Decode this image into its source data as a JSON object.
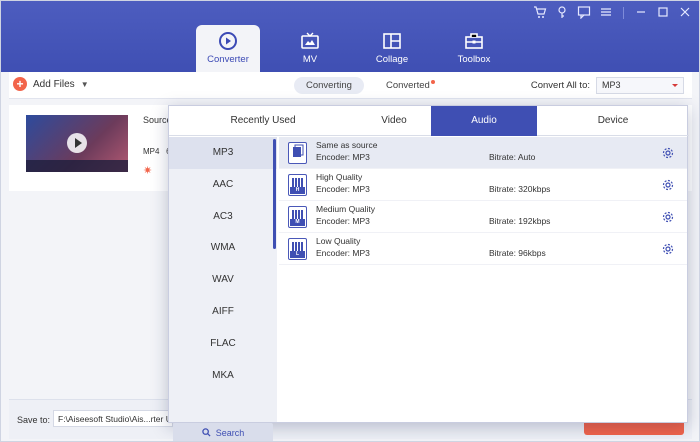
{
  "window": {
    "controls": [
      "cart-icon",
      "key-icon",
      "feedback-icon",
      "menu-icon",
      "minimize-icon",
      "maximize-icon",
      "close-icon"
    ]
  },
  "nav": {
    "tabs": [
      {
        "label": "Converter",
        "icon": "converter-icon",
        "active": true
      },
      {
        "label": "MV",
        "icon": "tv-icon",
        "active": false
      },
      {
        "label": "Collage",
        "icon": "collage-icon",
        "active": false
      },
      {
        "label": "Toolbox",
        "icon": "toolbox-icon",
        "active": false
      }
    ]
  },
  "toolbar": {
    "add_files": "Add Files",
    "converting": "Converting",
    "converted": "Converted",
    "convert_all_label": "Convert All to:",
    "convert_all_value": "MP3"
  },
  "file": {
    "source_label": "Source",
    "format": "MP4",
    "format_extra": "6"
  },
  "bottom": {
    "save_to_label": "Save to:",
    "save_path": "F:\\Aiseesoft Studio\\Ais...rter U"
  },
  "popup": {
    "tabs": [
      "Recently Used",
      "Video",
      "Audio",
      "Device"
    ],
    "active_tab": "Audio",
    "formats": [
      "MP3",
      "AAC",
      "AC3",
      "WMA",
      "WAV",
      "AIFF",
      "FLAC",
      "MKA"
    ],
    "active_format": "MP3",
    "search_label": "Search",
    "presets": [
      {
        "name": "Same as source",
        "encoder": "Encoder: MP3",
        "bitrate": "Bitrate: Auto",
        "tag": ""
      },
      {
        "name": "High Quality",
        "encoder": "Encoder: MP3",
        "bitrate": "Bitrate: 320kbps",
        "tag": "H"
      },
      {
        "name": "Medium Quality",
        "encoder": "Encoder: MP3",
        "bitrate": "Bitrate: 192kbps",
        "tag": "M"
      },
      {
        "name": "Low Quality",
        "encoder": "Encoder: MP3",
        "bitrate": "Bitrate: 96kbps",
        "tag": "L"
      }
    ]
  },
  "colors": {
    "brand": "#3f4fb3",
    "accent": "#f2644a"
  }
}
